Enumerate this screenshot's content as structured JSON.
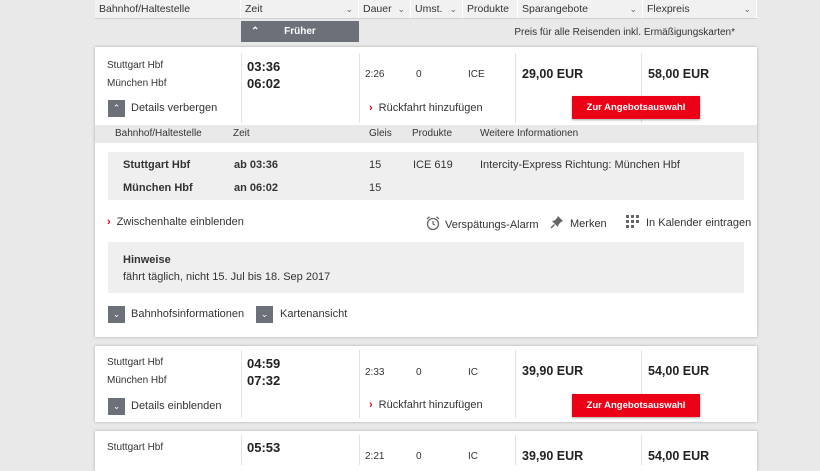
{
  "header": {
    "cols": [
      {
        "label": "Bahnhof/Haltestelle",
        "chev": false
      },
      {
        "label": "Zeit",
        "chev": true
      },
      {
        "label": "Dauer",
        "chev": true
      },
      {
        "label": "Umst.",
        "chev": true
      },
      {
        "label": "Produkte",
        "chev": false
      },
      {
        "label": "Sparangebote",
        "chev": true
      },
      {
        "label": "Flexpreis",
        "chev": true
      }
    ]
  },
  "earlier_label": "Früher",
  "price_note": "Preis für alle Reisenden inkl. Ermäßigungskarten*",
  "connections": [
    {
      "from": "Stuttgart Hbf",
      "to": "München Hbf",
      "dep": "03:36",
      "arr": "06:02",
      "duration": "2:26",
      "changes": "0",
      "product": "ICE",
      "saver_price": "29,00 EUR",
      "flex_price": "58,00 EUR",
      "details_label": "Details verbergen",
      "return_label": "Rückfahrt hinzufügen",
      "offer_label": "Zur Angebotsauswahl"
    },
    {
      "from": "Stuttgart Hbf",
      "to": "München Hbf",
      "dep": "04:59",
      "arr": "07:32",
      "duration": "2:33",
      "changes": "0",
      "product": "IC",
      "saver_price": "39,90 EUR",
      "flex_price": "54,00 EUR",
      "details_label": "Details einblenden",
      "return_label": "Rückfahrt hinzufügen",
      "offer_label": "Zur Angebotsauswahl"
    },
    {
      "from": "Stuttgart Hbf",
      "to": "",
      "dep": "05:53",
      "arr": "",
      "duration": "2:21",
      "changes": "0",
      "product": "IC",
      "saver_price": "39,90 EUR",
      "flex_price": "54,00 EUR"
    }
  ],
  "details": {
    "headers": [
      "Bahnhof/Haltestelle",
      "Zeit",
      "Gleis",
      "Produkte",
      "Weitere Informationen"
    ],
    "stops": [
      {
        "station": "Stuttgart Hbf",
        "time": "ab 03:36",
        "track": "15",
        "product": "ICE 619",
        "info": "Intercity-Express Richtung: München Hbf"
      },
      {
        "station": "München Hbf",
        "time": "an 06:02",
        "track": "15",
        "product": "",
        "info": ""
      }
    ],
    "intermediate_label": "Zwischenhalte einblenden",
    "delay_alarm": "Verspätungs-Alarm",
    "bookmark": "Merken",
    "calendar": "In Kalender eintragen",
    "notes_title": "Hinweise",
    "notes_text": "fährt täglich, nicht 15. Jul bis 18. Sep 2017",
    "station_info": "Bahnhofsinformationen",
    "map_view": "Kartenansicht"
  }
}
